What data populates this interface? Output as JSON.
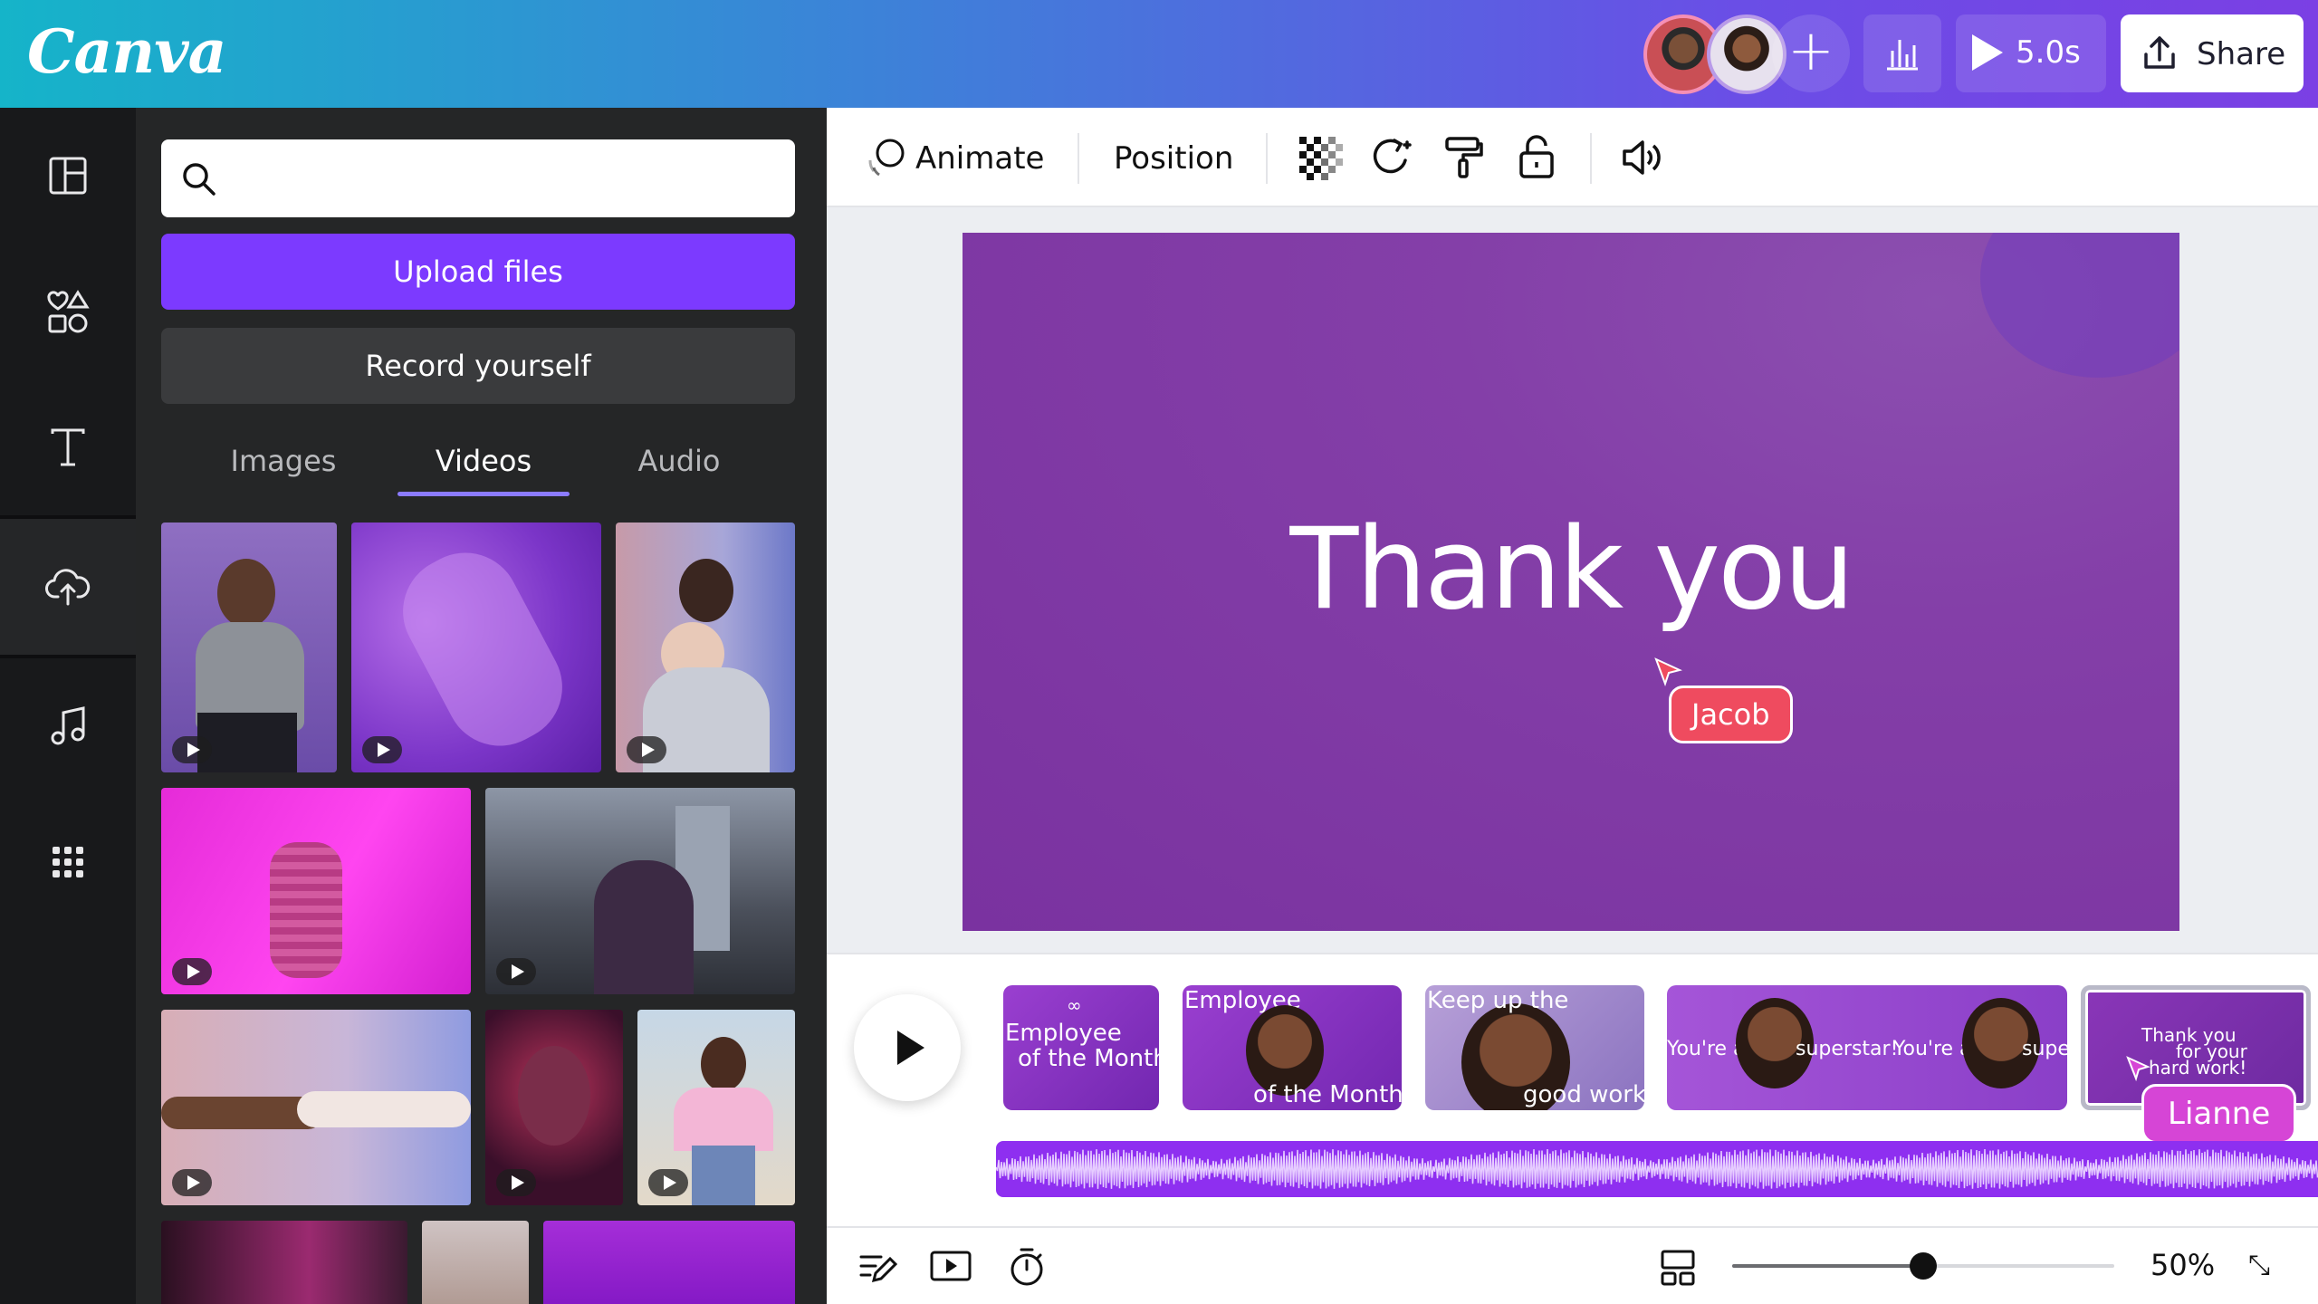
{
  "app": {
    "logo": "Canva"
  },
  "topbar": {
    "avatars": [
      {
        "name": "collaborator-1"
      },
      {
        "name": "collaborator-2"
      }
    ],
    "add_label": "+",
    "play_duration": "5.0s",
    "share_label": "Share"
  },
  "sidebar": {
    "items": [
      {
        "icon": "layout-icon"
      },
      {
        "icon": "elements-icon"
      },
      {
        "icon": "text-icon"
      },
      {
        "icon": "upload-icon",
        "active": true
      },
      {
        "icon": "music-icon"
      },
      {
        "icon": "apps-icon"
      }
    ]
  },
  "panel": {
    "search_placeholder": "",
    "upload_label": "Upload files",
    "record_label": "Record yourself",
    "tabs": [
      {
        "label": "Images"
      },
      {
        "label": "Videos",
        "active": true
      },
      {
        "label": "Audio"
      }
    ]
  },
  "toolbar": {
    "animate_label": "Animate",
    "position_label": "Position"
  },
  "canvas": {
    "slide_title": "Thank you",
    "cursor_label": "Jacob"
  },
  "timeline": {
    "scenes": [
      {
        "lines": [
          "Employee",
          "of the Month"
        ]
      },
      {
        "lines": [
          "Employee",
          "of the Month"
        ]
      },
      {
        "lines": [
          "Keep up the",
          "good work!"
        ]
      },
      {
        "lines": [
          "You're a",
          "superstar!",
          "You're a",
          "super"
        ]
      },
      {
        "lines": [
          "Thank you",
          "for your",
          "hard work!"
        ]
      }
    ],
    "cursor_label": "Lianne"
  },
  "footer": {
    "zoom_value": "50%",
    "zoom_fraction": 0.5
  },
  "colors": {
    "accent": "#7c3aff",
    "jacob": "#ef4b5f",
    "lianne": "#d645d6",
    "slide": "#7a32a0"
  }
}
